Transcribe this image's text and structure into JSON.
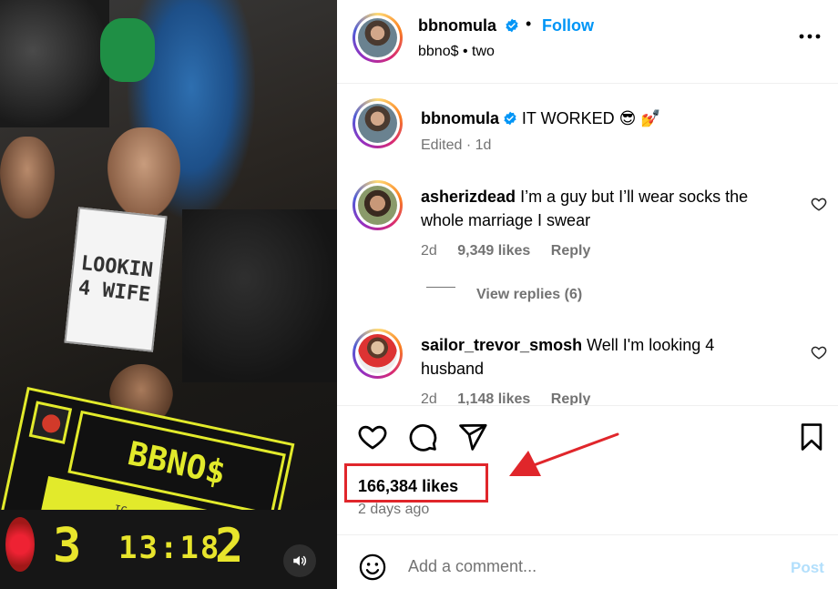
{
  "media": {
    "sign_line1": "LOOKIN",
    "sign_line2": "4 WIFE",
    "banner_name": "BBNO$",
    "banner_handle": "IG: @BBNOMULA",
    "score_home": "3",
    "score_clock": "13:18",
    "score_away": "2",
    "volume_icon": "speaker-icon"
  },
  "header": {
    "username": "bbnomula",
    "verified": true,
    "dot": "•",
    "follow_label": "Follow",
    "audio": "bbno$",
    "audio_sep": "•",
    "audio_track": "two",
    "more_icon": "more-horizontal-icon"
  },
  "caption": {
    "username": "bbnomula",
    "text": "IT WORKED 😎 💅",
    "edited": "Edited",
    "sep": "·",
    "age": "1d"
  },
  "comments": [
    {
      "username": "asherizdead",
      "text_line1": "I’m a guy but I’ll wear socks the",
      "text_line2": "whole marriage I swear",
      "age": "2d",
      "likes": "9,349 likes",
      "reply_label": "Reply",
      "view_replies": "View replies (6)"
    },
    {
      "username": "sailor_trevor_smosh",
      "text_line1": "Well I'm looking 4",
      "text_line2": "husband",
      "age": "2d",
      "likes": "1,148 likes",
      "reply_label": "Reply"
    }
  ],
  "actions": {
    "like_icon": "heart-icon",
    "comment_icon": "comment-icon",
    "share_icon": "send-icon",
    "save_icon": "bookmark-icon",
    "likes": "166,384 likes",
    "posted": "2 days ago"
  },
  "composer": {
    "emoji_icon": "emoji-icon",
    "placeholder": "Add a comment...",
    "value": "",
    "post_label": "Post"
  },
  "colors": {
    "accent": "#0095f6",
    "highlight_red": "#e0262b",
    "muted": "#737373",
    "post_disabled": "#b2dffc"
  }
}
